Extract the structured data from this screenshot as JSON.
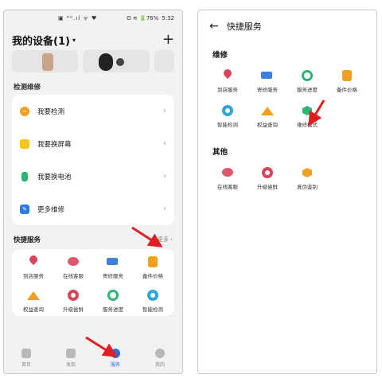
{
  "left": {
    "status": {
      "left": "▣ ⁴ᴳ.ıl ᯤ ♥",
      "right": "ʘ ≋ 🔋76%",
      "time": "5:32"
    },
    "header": {
      "title": "我的设备(1)",
      "caret": "▾",
      "add": "+"
    },
    "repair": {
      "label": "检测维修",
      "items": [
        {
          "label": "我要检测",
          "icon": "heart-check-icon",
          "color": "#f0a020"
        },
        {
          "label": "我要换屏幕",
          "icon": "screen-icon",
          "color": "#f5c518"
        },
        {
          "label": "我要换电池",
          "icon": "battery-icon",
          "color": "#2bb673"
        },
        {
          "label": "更多维修",
          "icon": "wrench-icon",
          "color": "#2a7de1"
        }
      ]
    },
    "quick": {
      "label": "快捷服务",
      "more": "更多 ›",
      "items": [
        {
          "label": "到店服务",
          "icon": "location-pin-icon"
        },
        {
          "label": "在线客服",
          "icon": "chat-bubble-icon"
        },
        {
          "label": "寄修服务",
          "icon": "truck-icon"
        },
        {
          "label": "备件价格",
          "icon": "coins-icon"
        },
        {
          "label": "权益查询",
          "icon": "crown-icon"
        },
        {
          "label": "升级尝鲜",
          "icon": "upgrade-icon"
        },
        {
          "label": "服务进度",
          "icon": "progress-icon"
        },
        {
          "label": "智能检测",
          "icon": "smart-check-icon"
        }
      ]
    },
    "tabs": [
      {
        "label": "首页",
        "icon": "home-icon",
        "active": false
      },
      {
        "label": "发现",
        "icon": "discover-icon",
        "active": false
      },
      {
        "label": "服务",
        "icon": "service-icon",
        "active": true
      },
      {
        "label": "我的",
        "icon": "profile-icon",
        "active": false
      }
    ]
  },
  "right": {
    "header": {
      "back": "←",
      "title": "快捷服务"
    },
    "sections": [
      {
        "title": "维修",
        "items": [
          {
            "label": "到店服务",
            "icon": "location-pin-icon"
          },
          {
            "label": "寄修服务",
            "icon": "truck-icon"
          },
          {
            "label": "服务进度",
            "icon": "progress-icon"
          },
          {
            "label": "备件价格",
            "icon": "coins-icon"
          },
          {
            "label": "智能检测",
            "icon": "smart-check-icon"
          },
          {
            "label": "权益查询",
            "icon": "crown-icon"
          },
          {
            "label": "维修模式",
            "icon": "repair-mode-icon"
          }
        ]
      },
      {
        "title": "其他",
        "items": [
          {
            "label": "在线客服",
            "icon": "chat-bubble-icon"
          },
          {
            "label": "升级尝鲜",
            "icon": "upgrade-icon"
          },
          {
            "label": "真伪鉴别",
            "icon": "authenticity-icon"
          }
        ]
      }
    ]
  },
  "colors": {
    "pin": "#d9445a",
    "bubble": "#e0566b",
    "truck": "#3b82e0",
    "coins": "#f0a020",
    "progress": "#2bb673",
    "crown": "#f0a020",
    "upgrade": "#d9445a",
    "smartcheck": "#2aa8d8",
    "repairmode": "#2bb673",
    "authenticity": "#f0a020",
    "annotation_arrow": "#e02020",
    "tab_active": "#2a6de0"
  }
}
